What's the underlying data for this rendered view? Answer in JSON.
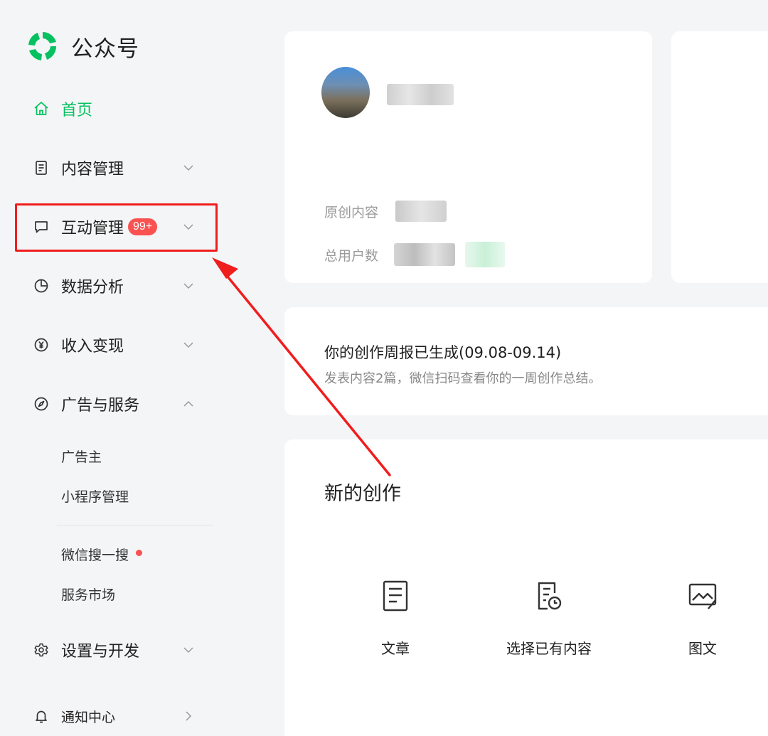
{
  "brand": {
    "name": "公众号",
    "logo_icon": "wechat-official-logo-icon",
    "color": "#07c160"
  },
  "sidebar": {
    "items": [
      {
        "label": "首页",
        "icon": "home-icon",
        "active": true
      },
      {
        "label": "内容管理",
        "icon": "document-icon",
        "expanded": false
      },
      {
        "label": "互动管理",
        "icon": "message-icon",
        "badge": "99+",
        "expanded": false
      },
      {
        "label": "数据分析",
        "icon": "pie-chart-icon",
        "expanded": false
      },
      {
        "label": "收入变现",
        "icon": "yen-icon",
        "expanded": false
      },
      {
        "label": "广告与服务",
        "icon": "compass-icon",
        "expanded": true
      },
      {
        "label": "设置与开发",
        "icon": "gear-icon",
        "expanded": false
      },
      {
        "label": "通知中心",
        "icon": "bell-icon",
        "expanded": false
      }
    ],
    "ad_sub_items": [
      "广告主",
      "小程序管理",
      "微信搜一搜",
      "服务市场"
    ]
  },
  "profile": {
    "stats": [
      {
        "label": "原创内容"
      },
      {
        "label": "总用户数"
      }
    ]
  },
  "report": {
    "title": "你的创作周报已生成(09.08-09.14)",
    "desc": "发表内容2篇，微信扫码查看你的一周创作总结。"
  },
  "create": {
    "title": "新的创作",
    "tiles": [
      {
        "label": "文章",
        "icon": "article-icon"
      },
      {
        "label": "选择已有内容",
        "icon": "existing-content-icon"
      },
      {
        "label": "图文",
        "icon": "image-text-icon"
      }
    ]
  },
  "colors": {
    "accent": "#07c160",
    "badge": "#fa5151",
    "annotation": "#f01d1d"
  }
}
